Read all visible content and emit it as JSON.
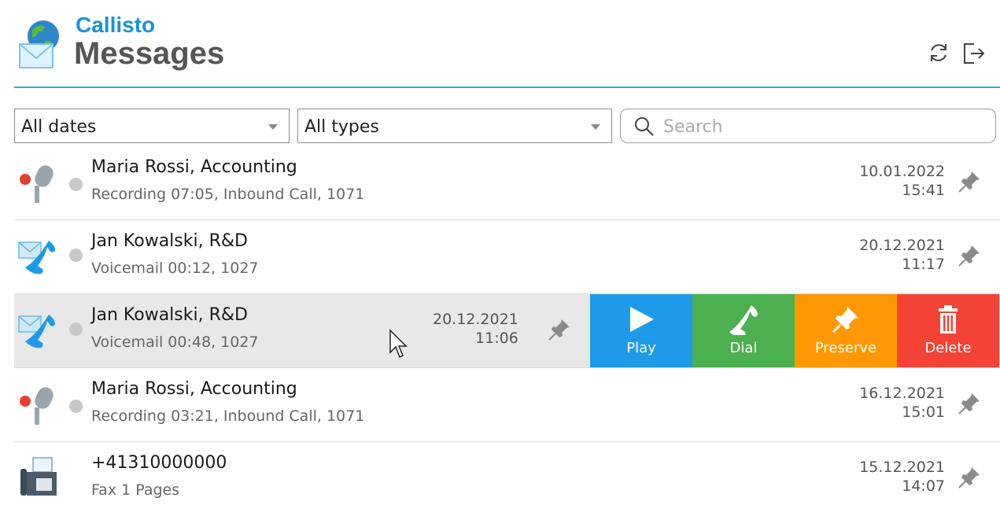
{
  "header": {
    "brand": "Callisto",
    "title": "Messages",
    "refresh_icon": "refresh-icon",
    "logout_icon": "logout-icon"
  },
  "filters": {
    "dates": {
      "value": "All dates",
      "icon": "chevron-down-icon"
    },
    "types": {
      "value": "All types",
      "icon": "chevron-down-icon"
    },
    "search": {
      "placeholder": "Search",
      "value": "",
      "icon": "search-icon"
    }
  },
  "messages": [
    {
      "kind": "recording",
      "icon": "microphone-icon",
      "name": "Maria Rossi, Accounting",
      "detail": "Recording 07:05, Inbound Call, 1071",
      "date": "10.01.2022",
      "time": "15:41"
    },
    {
      "kind": "voicemail",
      "icon": "voicemail-icon",
      "name": "Jan Kowalski, R&D",
      "detail": "Voicemail 00:12, 1027",
      "date": "20.12.2021",
      "time": "11:17"
    },
    {
      "kind": "voicemail",
      "icon": "voicemail-icon",
      "name": "Jan Kowalski, R&D",
      "detail": "Voicemail 00:48, 1027",
      "date": "20.12.2021",
      "time": "11:06",
      "selected": true
    },
    {
      "kind": "recording",
      "icon": "microphone-icon",
      "name": "Maria Rossi, Accounting",
      "detail": "Recording 03:21, Inbound Call, 1071",
      "date": "16.12.2021",
      "time": "15:01"
    },
    {
      "kind": "fax",
      "icon": "fax-icon",
      "name": "+41310000000",
      "detail": "Fax 1 Pages",
      "date": "15.12.2021",
      "time": "14:07"
    }
  ],
  "actions": {
    "play": "Play",
    "dial": "Dial",
    "preserve": "Preserve",
    "delete": "Delete"
  },
  "colors": {
    "accent": "#1c8fe0",
    "play": "#1e9be8",
    "dial": "#4caf50",
    "preserve": "#ff9800",
    "delete": "#f44336",
    "recording_dot": "#e5402f",
    "unread_dot": "#c8c8c8"
  }
}
